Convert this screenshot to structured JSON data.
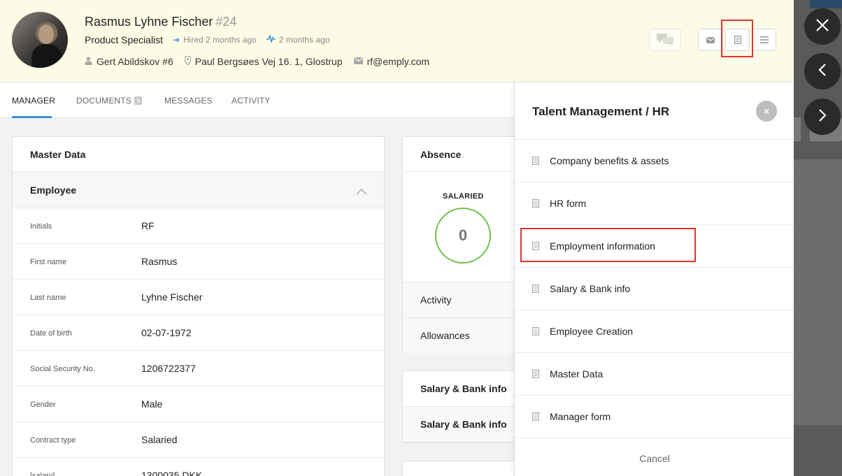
{
  "header": {
    "name": "Rasmus Lyhne Fischer",
    "number": "#24",
    "job_title": "Product Specialist",
    "hired_text": "Hired 2 months ago",
    "activity_text": "2 months ago",
    "manager": "Gert Abildskov #6",
    "address": "Paul Bergsøes Vej 16. 1, Glostrup",
    "email": "rf@emply.com"
  },
  "tabs": [
    {
      "label": "MANAGER",
      "active": true
    },
    {
      "label": "DOCUMENTS",
      "badge": "9"
    },
    {
      "label": "MESSAGES"
    },
    {
      "label": "ACTIVITY"
    }
  ],
  "master_data": {
    "title": "Master Data",
    "section": "Employee",
    "rows": [
      {
        "label": "Initials",
        "value": "RF"
      },
      {
        "label": "First name",
        "value": "Rasmus"
      },
      {
        "label": "Last name",
        "value": "Lyhne Fischer"
      },
      {
        "label": "Date of birth",
        "value": "02-07-1972"
      },
      {
        "label": "Social Security No.",
        "value": "1206722377"
      },
      {
        "label": "Gender",
        "value": "Male"
      },
      {
        "label": "Contract type",
        "value": "Salaried"
      },
      {
        "label": "[salary]",
        "value": "1300035 DKK"
      }
    ]
  },
  "absence": {
    "title": "Absence",
    "label": "SALARIED",
    "count": "0",
    "rows": [
      "Activity",
      "Allowances"
    ]
  },
  "salary_card": {
    "rows": [
      "Salary & Bank info",
      "Salary & Bank info"
    ]
  },
  "panel": {
    "title": "Talent Management / HR",
    "close_symbol": "×",
    "items": [
      "Company benefits & assets",
      "HR form",
      "Employment information",
      "Salary & Bank info",
      "Employee Creation",
      "Master Data",
      "Manager form"
    ],
    "cancel_label": "Cancel"
  },
  "colors": {
    "header_bg": "#fcfce6",
    "accent_blue": "#3a8fd8",
    "ring_green": "#6cc24a",
    "highlight_red": "#e0342e"
  }
}
